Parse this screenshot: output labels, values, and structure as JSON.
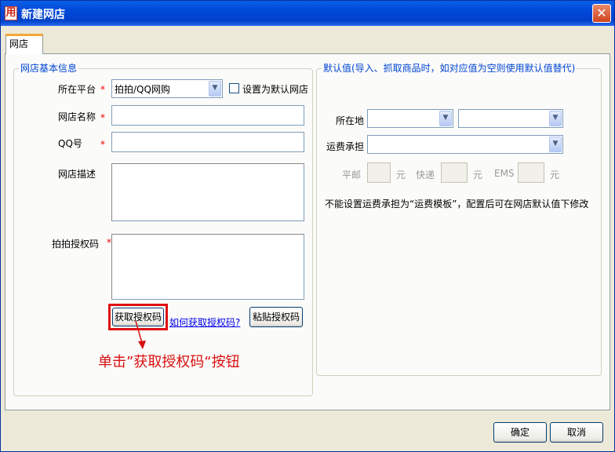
{
  "window": {
    "title": "新建网店",
    "app_icon": "用",
    "close_glyph": "✕"
  },
  "tab": {
    "label": "网店"
  },
  "basic": {
    "legend": "网店基本信息",
    "platform_label": "所在平台",
    "platform_value": "拍拍/QQ网购",
    "default_checkbox_label": "设置为默认网店",
    "shop_name_label": "网店名称",
    "qq_label": "QQ号",
    "desc_label": "网店描述",
    "auth_label": "拍拍授权码",
    "required_mark": "*",
    "get_auth_button": "获取授权码",
    "how_link": "如何获取授权码?",
    "paste_button": "粘贴授权码"
  },
  "defaults": {
    "legend": "默认值(导入、抓取商品时，如对应值为空则使用默认值替代)",
    "location_label": "所在地",
    "shipping_label": "运费承担",
    "pingyou_label": "平邮",
    "express_label": "快递",
    "ems_label": "EMS",
    "unit": "元",
    "note": "不能设置运费承担为“运费模板”，配置后可在网店默认值下修改"
  },
  "annotation": {
    "text": "单击”获取授权码“按钮",
    "color": "#d81010"
  },
  "footer": {
    "ok_button": "确定",
    "cancel_button": "取消"
  }
}
